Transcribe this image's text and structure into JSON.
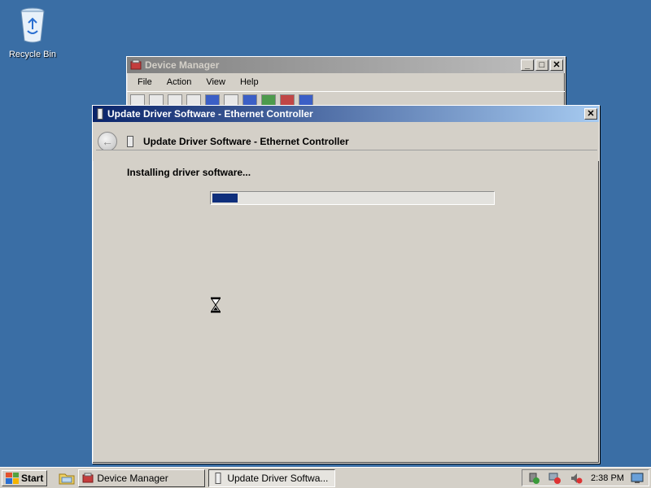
{
  "desktop": {
    "icons": [
      {
        "label": "Recycle Bin",
        "icon": "recycle-bin-icon"
      }
    ]
  },
  "device_manager": {
    "title": "Device Manager",
    "menu": [
      "File",
      "Action",
      "View",
      "Help"
    ]
  },
  "wizard": {
    "window_title": "Update Driver Software - Ethernet Controller",
    "header_title": "Update Driver Software - Ethernet Controller",
    "status": "Installing driver software...",
    "progress_fraction": 0.09
  },
  "taskbar": {
    "start_label": "Start",
    "tasks": [
      {
        "label": "Device Manager",
        "active": false
      },
      {
        "label": "Update Driver Softwa...",
        "active": true
      }
    ],
    "clock": "2:38 PM"
  },
  "colors": {
    "desktop": "#3a6ea5",
    "active_title": "#0a246a",
    "progress_fill": "#0f2f7c"
  }
}
